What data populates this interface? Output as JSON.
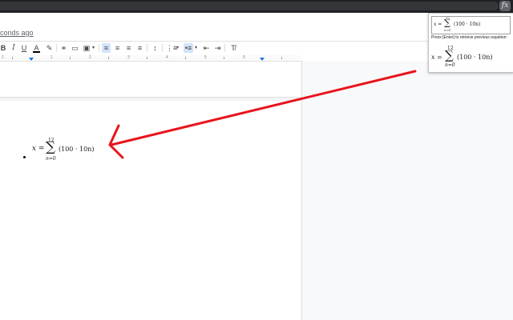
{
  "header": {
    "last_edit": "conds ago",
    "extension_icon": "fx"
  },
  "toolbar": {
    "items": [
      {
        "name": "bold-button",
        "label": "B"
      },
      {
        "name": "italic-button",
        "label": "I"
      },
      {
        "name": "underline-button",
        "label": "U"
      },
      {
        "name": "text-color-button",
        "label": "A"
      },
      {
        "name": "highlight-button",
        "label": "✎"
      },
      {
        "name": "link-button",
        "label": "⚭"
      },
      {
        "name": "comment-button",
        "label": "▭"
      },
      {
        "name": "image-button",
        "label": "▣"
      },
      {
        "name": "align-left-button",
        "label": "≡"
      },
      {
        "name": "align-center-button",
        "label": "≡"
      },
      {
        "name": "align-right-button",
        "label": "≡"
      },
      {
        "name": "justify-button",
        "label": "≡"
      },
      {
        "name": "line-spacing-button",
        "label": "↕"
      },
      {
        "name": "numbered-list-button",
        "label": "⋮≡"
      },
      {
        "name": "bulleted-list-button",
        "label": "•≡"
      },
      {
        "name": "decrease-indent-button",
        "label": "⇤"
      },
      {
        "name": "increase-indent-button",
        "label": "⇥"
      },
      {
        "name": "clear-formatting-button",
        "label": "T̸"
      }
    ]
  },
  "ruler": {
    "numbers": [
      "1",
      "1",
      "2",
      "3",
      "4",
      "5",
      "6"
    ]
  },
  "document": {
    "equation": {
      "lhs": "x =",
      "sigma": "∑",
      "upper": "12",
      "lower": "n=0",
      "rhs": "(100 · 10n)"
    }
  },
  "popup": {
    "input_equation": {
      "lhs": "x =",
      "sigma": "∑",
      "upper": "12",
      "lower": "n=0",
      "rhs": "(100 · 10n)"
    },
    "hint": "Press [Enter] to retrieve previous equation:",
    "preview_equation": {
      "lhs": "x =",
      "sigma": "∑",
      "upper": "12",
      "lower": "n=0",
      "rhs": "(100 · 10n)"
    }
  },
  "colors": {
    "arrow": "#e8141c",
    "accent": "#1a73e8",
    "topbar": "#202124"
  }
}
